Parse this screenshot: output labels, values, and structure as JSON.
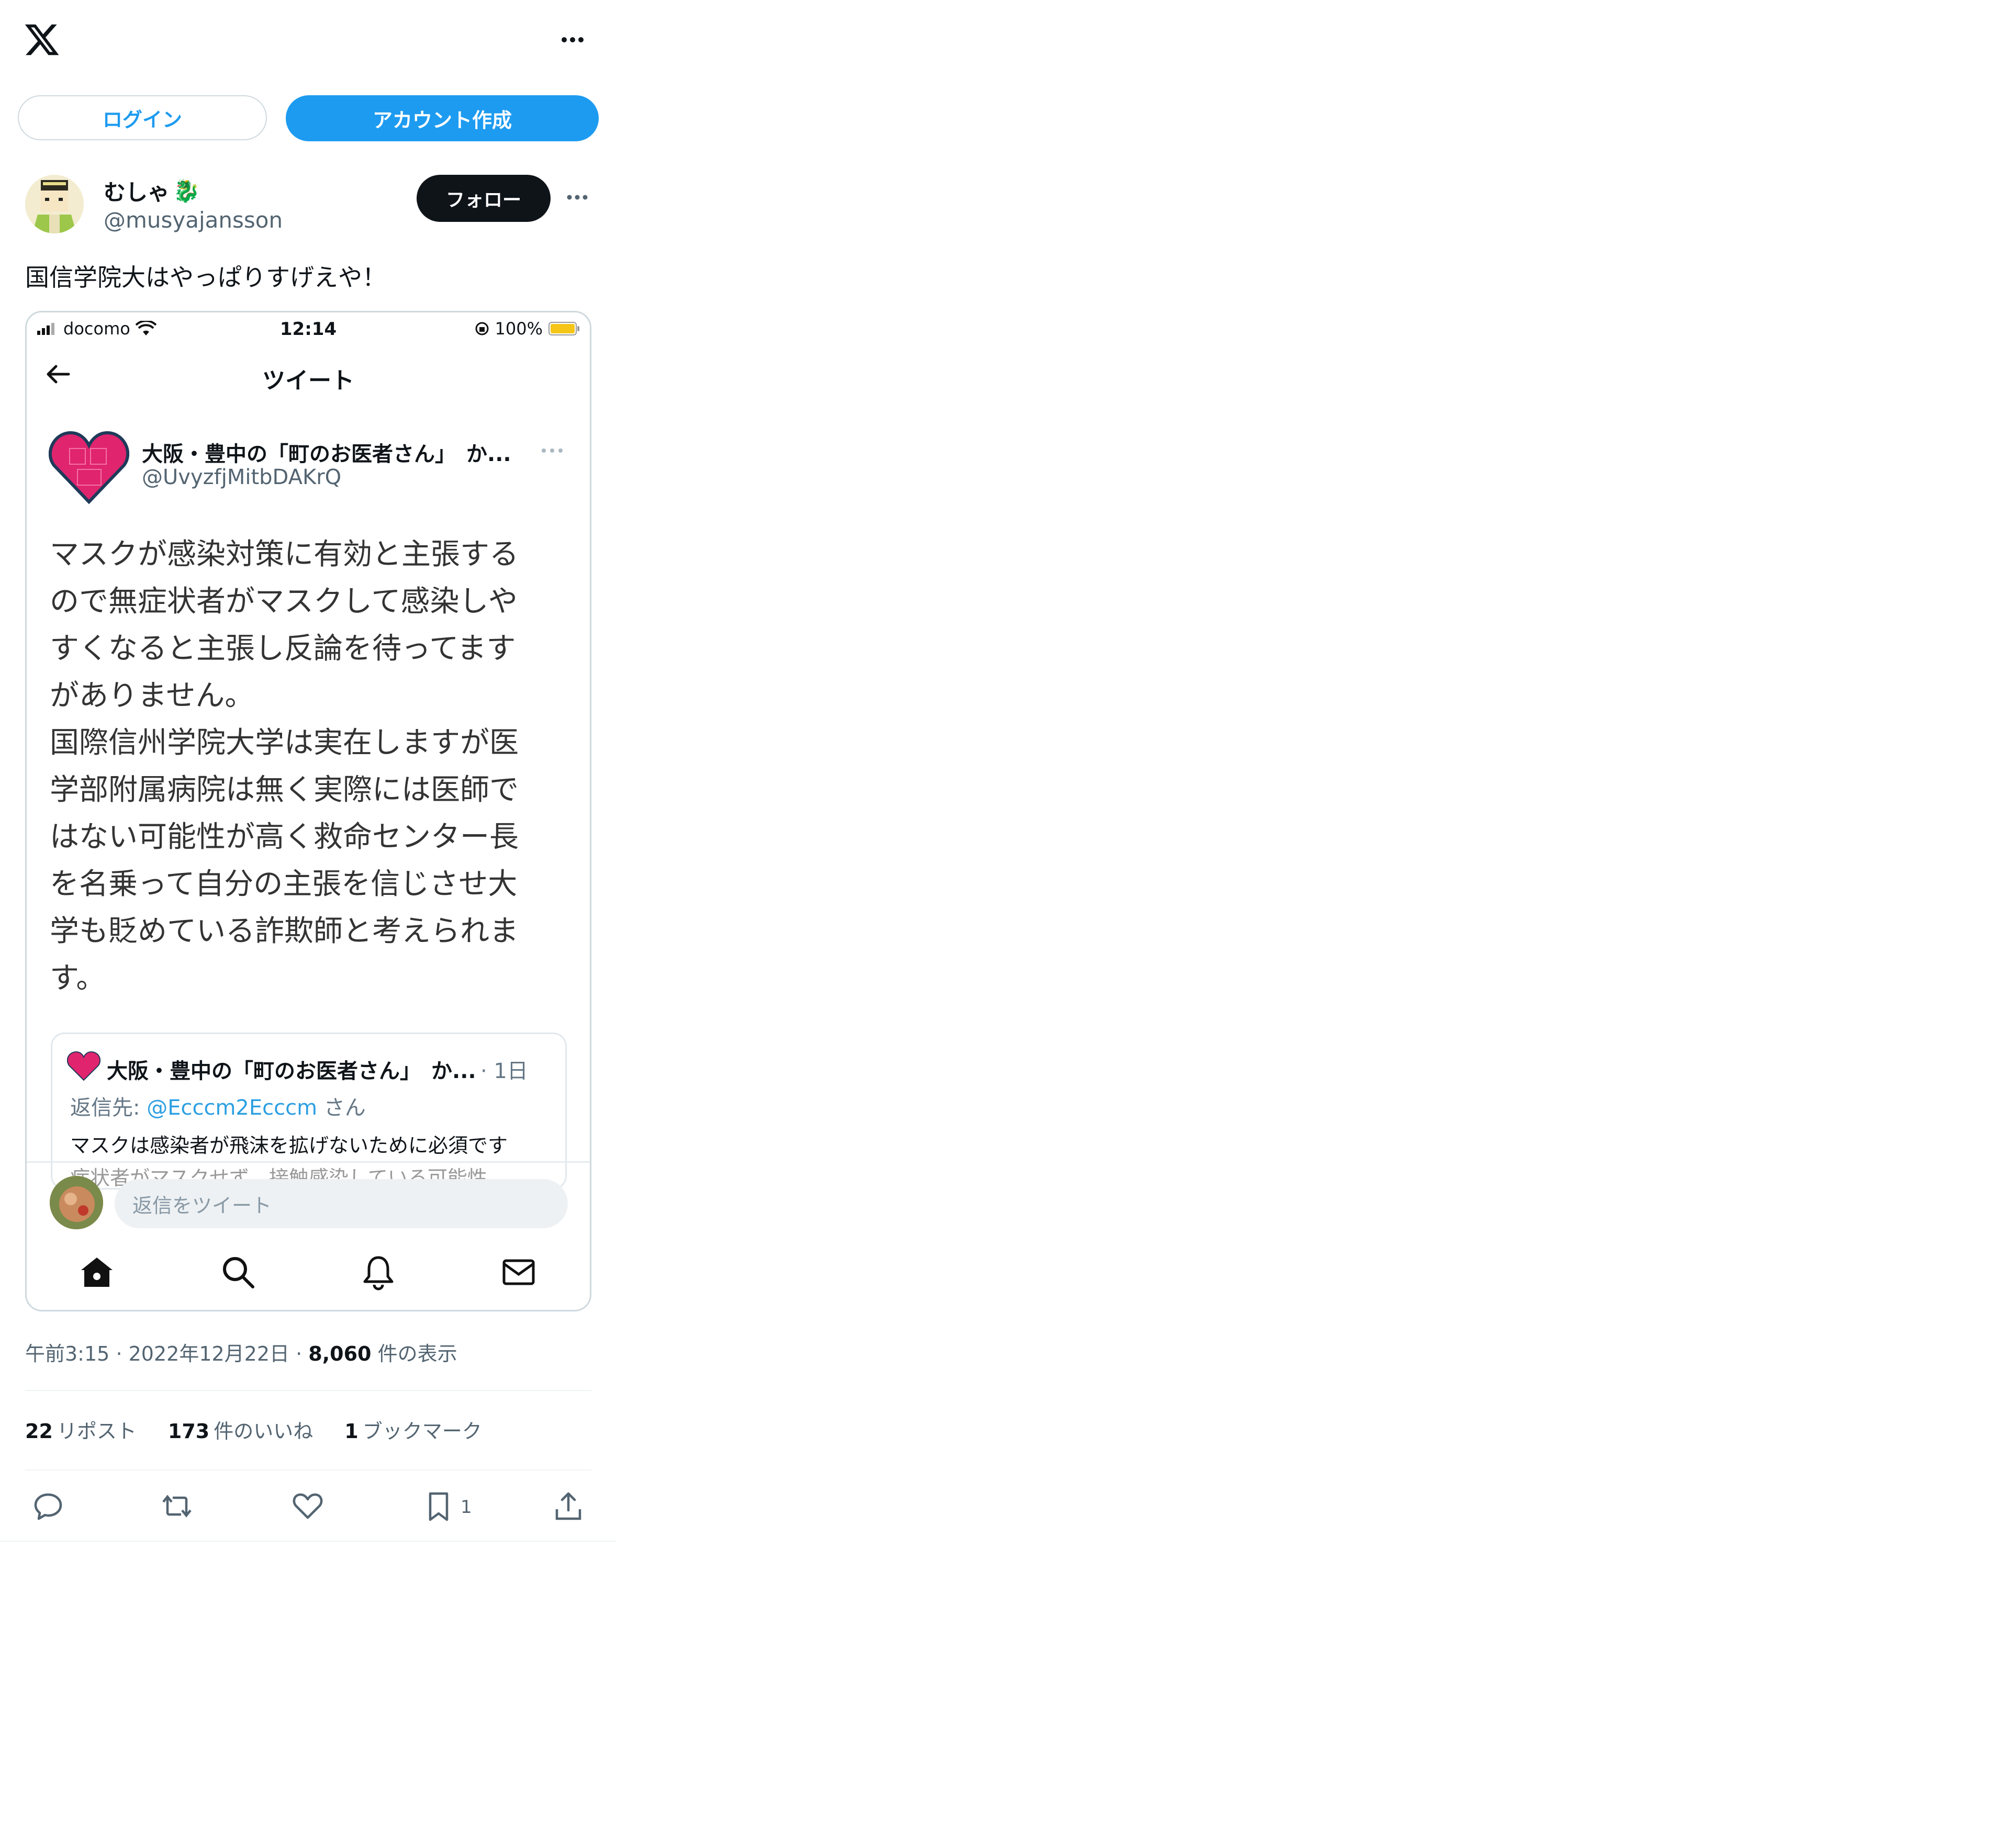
{
  "header": {
    "more_label": "•••"
  },
  "auth": {
    "login_label": "ログイン",
    "signup_label": "アカウント作成"
  },
  "author": {
    "name": "むしゃ",
    "name_emoji": "🐉",
    "handle": "@musyajansson",
    "follow_label": "フォロー"
  },
  "tweet": {
    "text": "国信学院大はやっぱりすげえや！"
  },
  "embedded": {
    "status": {
      "carrier": "docomo",
      "time": "12:14",
      "battery": "100%"
    },
    "nav_title": "ツイート",
    "quoted": {
      "name": "大阪・豊中の「町のお医者さん」　か...",
      "handle": "@UvyzfjMitbDAKrQ",
      "body": "マスクが感染対策に有効と主張する\nので無症状者がマスクして感染しや\nすくなると主張し反論を待ってます\nがありません。\n国際信州学院大学は実在しますが医\n学部附属病院は無く実際には医師で\nはない可能性が高く救命センター長\nを名乗って自分の主張を信じさせ大\n学も貶めている詐欺師と考えられま\nす。"
    },
    "inner_card": {
      "name": "大阪・豊中の「町のお医者さん」　か...",
      "date": "· 1日",
      "reply_prefix": "返信先: ",
      "reply_mention": "@Ecccm2Ecccm",
      "reply_suffix": " さん",
      "text": "マスクは感染者が飛沫を拡げないために必須です",
      "text_cut": "症状者がマスクせず　接触感染している可能性"
    },
    "reply_placeholder": "返信をツイート"
  },
  "meta": {
    "time": "午前3:15",
    "date": "2022年12月22日",
    "views": "8,060",
    "views_label": "件の表示"
  },
  "stats": {
    "reposts": "22",
    "reposts_label": "リポスト",
    "likes": "173",
    "likes_label": "件のいいね",
    "bookmarks": "1",
    "bookmarks_label": "ブックマーク"
  },
  "actions": {
    "bookmark_count": "1"
  },
  "colors": {
    "accent": "#1d9bf0",
    "text": "#0f1419",
    "muted": "#536471",
    "heart": "#e0246e",
    "battery": "#f5c518"
  }
}
